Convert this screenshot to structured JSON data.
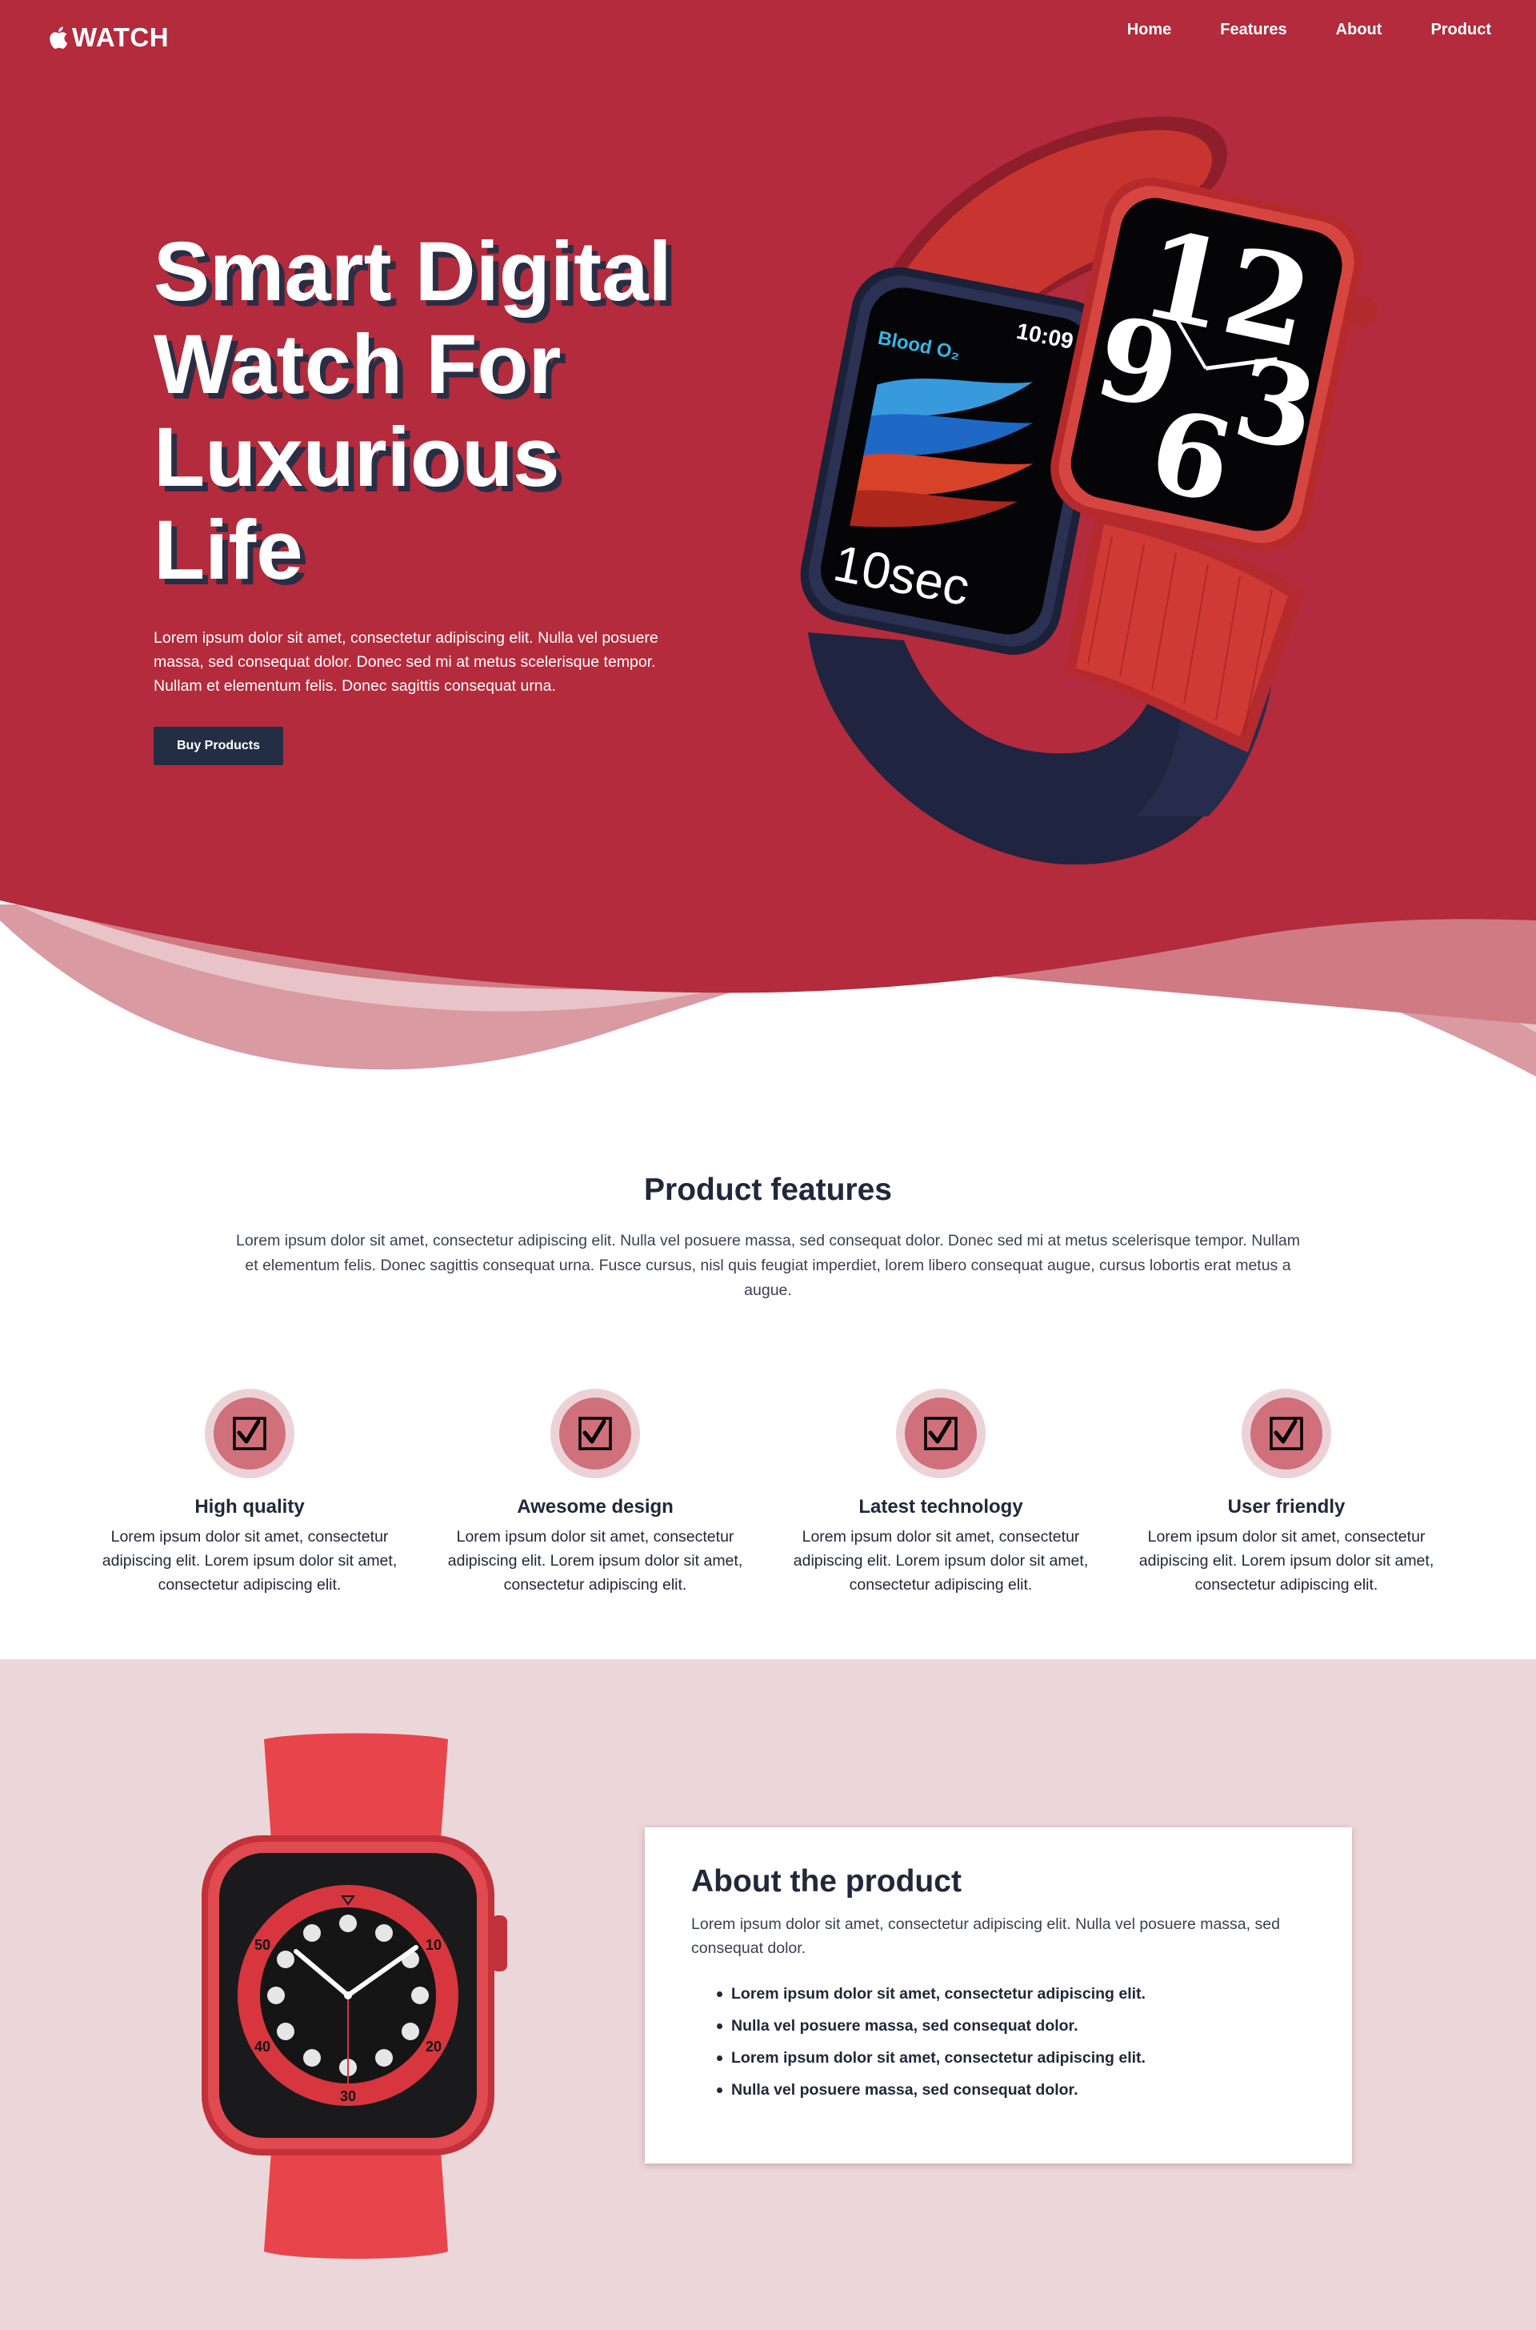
{
  "nav": {
    "logo_text": "WATCH",
    "logo_icon": "apple-icon",
    "links": [
      "Home",
      "Features",
      "About",
      "Product"
    ]
  },
  "hero": {
    "title_lines": [
      "Smart Digital",
      "Watch For",
      "Luxurious",
      "Life"
    ],
    "description": "Lorem ipsum dolor sit amet, consectetur adipiscing elit. Nulla vel posuere massa, sed consequat dolor. Donec sed mi at metus scelerisque tempor. Nullam et elementum felis. Donec sagittis consequat urna.",
    "button_label": "Buy Products",
    "watch_left_time": "10:09",
    "watch_left_label": "Blood O₂",
    "watch_left_readout": "10sec",
    "watch_right_digits": [
      "12",
      "9",
      "3",
      "6"
    ]
  },
  "features": {
    "title": "Product features",
    "description": "Lorem ipsum dolor sit amet, consectetur adipiscing elit. Nulla vel posuere massa, sed consequat dolor. Donec sed mi at metus scelerisque tempor. Nullam et elementum felis. Donec sagittis consequat urna. Fusce cursus, nisl quis feugiat imperdiet, lorem libero consequat augue, cursus lobortis erat metus a augue.",
    "items": [
      {
        "icon": "☑",
        "title": "High quality",
        "desc": "Lorem ipsum dolor sit amet, consectetur adipiscing elit. Lorem ipsum dolor sit amet, consectetur adipiscing elit."
      },
      {
        "icon": "☑",
        "title": "Awesome design",
        "desc": "Lorem ipsum dolor sit amet, consectetur adipiscing elit. Lorem ipsum dolor sit amet, consectetur adipiscing elit."
      },
      {
        "icon": "☑",
        "title": "Latest technology",
        "desc": "Lorem ipsum dolor sit amet, consectetur adipiscing elit. Lorem ipsum dolor sit amet, consectetur adipiscing elit."
      },
      {
        "icon": "☑",
        "title": "User friendly",
        "desc": "Lorem ipsum dolor sit amet, consectetur adipiscing elit. Lorem ipsum dolor sit amet, consectetur adipiscing elit."
      }
    ]
  },
  "about": {
    "title": "About the product",
    "description": "Lorem ipsum dolor sit amet, consectetur adipiscing elit. Nulla vel posuere massa, sed consequat dolor.",
    "list": [
      "Lorem ipsum dolor sit amet, consectetur adipiscing elit.",
      "Nulla vel posuere massa, sed consequat dolor.",
      "Lorem ipsum dolor sit amet, consectetur adipiscing elit.",
      "Nulla vel posuere massa, sed consequat dolor."
    ],
    "dial_numbers": [
      "10",
      "50",
      "40",
      "30",
      "20"
    ]
  },
  "colors": {
    "brand_red": "#b32b3c",
    "dark_navy": "#232d44",
    "about_bg": "#ebd7da",
    "icon_ring": "#ecd2d6",
    "icon_fill": "#cf707b"
  }
}
